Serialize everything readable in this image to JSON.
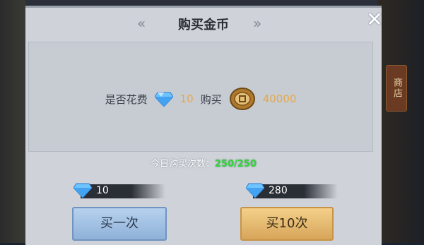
{
  "dialog": {
    "title": "购买金币",
    "left_arrows": "«",
    "right_arrows": "»",
    "close_symbol": "✕"
  },
  "prompt": {
    "prefix": "是否花费",
    "diamond_amount": "10",
    "middle": "购买",
    "gold_amount": "40000"
  },
  "daily_limit": {
    "label": "今日购买次数：",
    "count": "250/250"
  },
  "buy_once": {
    "cost": "10",
    "label": "买一次"
  },
  "buy_ten": {
    "cost": "280",
    "label": "买10次"
  },
  "background": {
    "shop_label": "商店"
  },
  "colors": {
    "accent_number": "#e5a84b",
    "count_green": "#34d43a",
    "blue_button": "#a9c6e8",
    "gold_button": "#e6bb73"
  }
}
